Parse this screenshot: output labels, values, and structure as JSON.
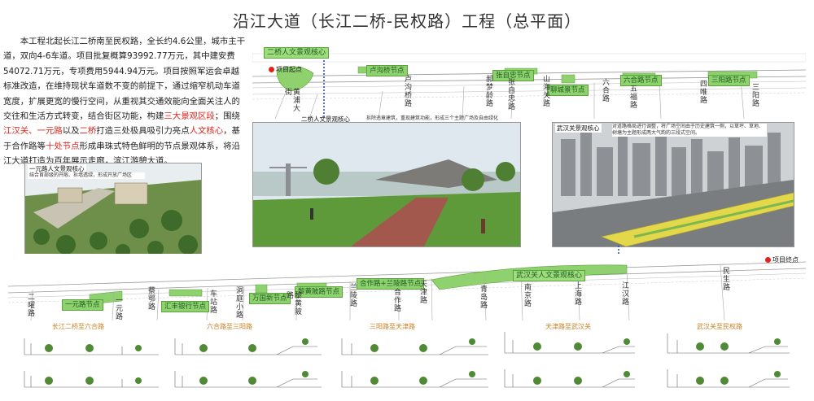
{
  "title": "沿江大道（长江二桥-民权路）工程（总平面）",
  "intro": {
    "p1": "本工程北起长江二桥南至民权路，全长约4.6公里，城市主干道，双向4-6车道。项目批复概算93992.77万元，其中建安费54072.71万元，专项费用5944.94万元。项目按照军运会卓越标准改造，在维持现状车道数不变的前提下，通过缩窄机动车道宽度，扩展更宽的慢行空间，从重视其交通效能向全面关注人的交往和生活方式转变，结合街区功能，构建",
    "hl1": "三大景观区段",
    "p2": "；围绕",
    "hl2": "江汉关、一元路",
    "p3": "以及",
    "hl3": "二桥",
    "p4": "打造三处极具吸引力亮点",
    "hl4": "人文核心",
    "p5": "，基于合作路等",
    "hl5": "十处节点",
    "p6": "形成串珠式特色鲜明的节点景观体系，将沿江大道打造为百年展示走廊，滨江游憩大道。"
  },
  "colors": {
    "accent_red": "#e2231a",
    "green_zone": "#8fd16e",
    "section_orange": "#c97f1f",
    "axis_blue": "#2a52be"
  },
  "top_plan": {
    "tags": {
      "erqiao": "二桥人文景观核心",
      "luhan": "卢沟桥节点",
      "zhangzizhong": "张自忠节点",
      "lijiang": "聊城景节点",
      "liuhe": "六合路节点",
      "sanyang": "三阳路节点"
    },
    "markers": {
      "start": "项目起点"
    },
    "roads": [
      "黄浦大街",
      "卢沟桥路",
      "郝梦龄路",
      "张自忠路",
      "山海关路",
      "六合路",
      "五福路",
      "四唯路",
      "三阳路"
    ]
  },
  "bottom_plan": {
    "tags": {
      "yiyuan": "一元路节点",
      "huiting": "汇丰银行节点",
      "wanguo": "万国新节点",
      "liyuan": "黎黄陂路节点",
      "hezuo": "合作路+兰陵路节点",
      "jianghan": "武汉关人文景观核心"
    },
    "markers": {
      "end": "项目终点"
    },
    "roads": [
      "二曜路",
      "一元路",
      "蔡鄂路",
      "车站路",
      "洞庭小路",
      "黎黄陂路",
      "兰陵路",
      "合作路",
      "天津路",
      "青岛路",
      "南京路",
      "上海路",
      "江汉路",
      "民生路"
    ]
  },
  "photo_left": {
    "title": "一元路人文景观核心",
    "desc": "结合首部级的开敞、拆墙透绿，形成开放广场区"
  },
  "photo_mid": {
    "title": "二桥人文景观核心",
    "desc": "拆除违章建筑，重现建筑功能，形成三个主题广场及自由绿化"
  },
  "photo_right": {
    "title": "武汉关景观核心",
    "desc": "对道路格局进行调整，将广场空间由于历史建筑一侧，以草坪、草地、树塘为主题形成两大气韵的三段式空间。"
  },
  "sections": [
    {
      "title": "长江二桥至六合路"
    },
    {
      "title": "六合路至三阳路"
    },
    {
      "title": "三阳路至天津路"
    },
    {
      "title": "天津路至武汉关"
    },
    {
      "title": "武汉关至民权路"
    }
  ]
}
